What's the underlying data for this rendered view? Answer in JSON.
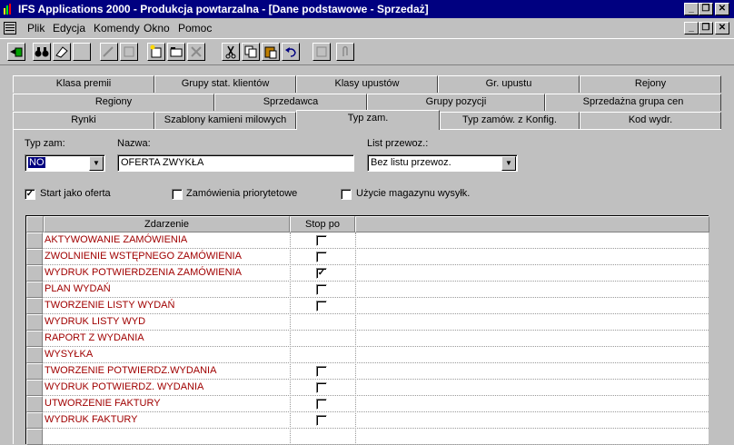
{
  "window": {
    "title": "IFS Applications 2000 - Produkcja powtarzalna - [Dane podstawowe - Sprzedaż]",
    "minimize": "_",
    "restore": "❐",
    "close": "✕"
  },
  "menu": [
    {
      "label": "Plik"
    },
    {
      "label": "Edycja"
    },
    {
      "label": "Komendy"
    },
    {
      "label": "Okno"
    },
    {
      "label": "Pomoc"
    }
  ],
  "tabs": {
    "row1": [
      "Klasa premii",
      "Grupy stat. klientów",
      "Klasy upustów",
      "Gr. upustu",
      "Rejony"
    ],
    "row2": [
      "Regiony",
      "Sprzedawca",
      "Grupy pozycji",
      "Sprzedażna grupa cen"
    ],
    "row3": [
      "Rynki",
      "Szablony kamieni milowych",
      "Typ zam.",
      "Typ zamów. z Konfig.",
      "Kod wydr."
    ]
  },
  "form": {
    "typ_zam_label": "Typ zam:",
    "typ_zam_value": "NO",
    "nazwa_label": "Nazwa:",
    "nazwa_value": "OFERTA ZWYKŁA",
    "list_przewoz_label": "List przewoz.:",
    "list_przewoz_value": "Bez listu przewoz.",
    "start_jako_oferta_label": "Start jako oferta",
    "zamowienia_priorytetowe_label": "Zamówienia priorytetowe",
    "uzycie_magazynu_label": "Użycie magazynu wysyłk."
  },
  "grid": {
    "col_zdarzenie": "Zdarzenie",
    "col_stop_po": "Stop po",
    "rows": [
      {
        "zdarzenie": "AKTYWOWANIE ZAMÓWIENIA",
        "stop": "unchecked"
      },
      {
        "zdarzenie": "ZWOLNIENIE WSTĘPNEGO ZAMÓWIENIA",
        "stop": "unchecked"
      },
      {
        "zdarzenie": "WYDRUK POTWIERDZENIA ZAMÓWIENIA",
        "stop": "checked"
      },
      {
        "zdarzenie": "PLAN WYDAŃ",
        "stop": "unchecked"
      },
      {
        "zdarzenie": "TWORZENIE LISTY WYDAŃ",
        "stop": "unchecked"
      },
      {
        "zdarzenie": "WYDRUK LISTY WYD",
        "stop": "none"
      },
      {
        "zdarzenie": "RAPORT Z WYDANIA",
        "stop": "none"
      },
      {
        "zdarzenie": "WYSYŁKA",
        "stop": "none"
      },
      {
        "zdarzenie": "TWORZENIE POTWIERDZ.WYDANIA",
        "stop": "unchecked"
      },
      {
        "zdarzenie": "WYDRUK POTWIERDZ. WYDANIA",
        "stop": "unchecked"
      },
      {
        "zdarzenie": "UTWORZENIE FAKTURY",
        "stop": "unchecked"
      },
      {
        "zdarzenie": "WYDRUK FAKTURY",
        "stop": "unchecked"
      }
    ]
  },
  "colors": {
    "titlebar": "#000080",
    "event_text": "#a00000",
    "face": "#c0c0c0"
  }
}
